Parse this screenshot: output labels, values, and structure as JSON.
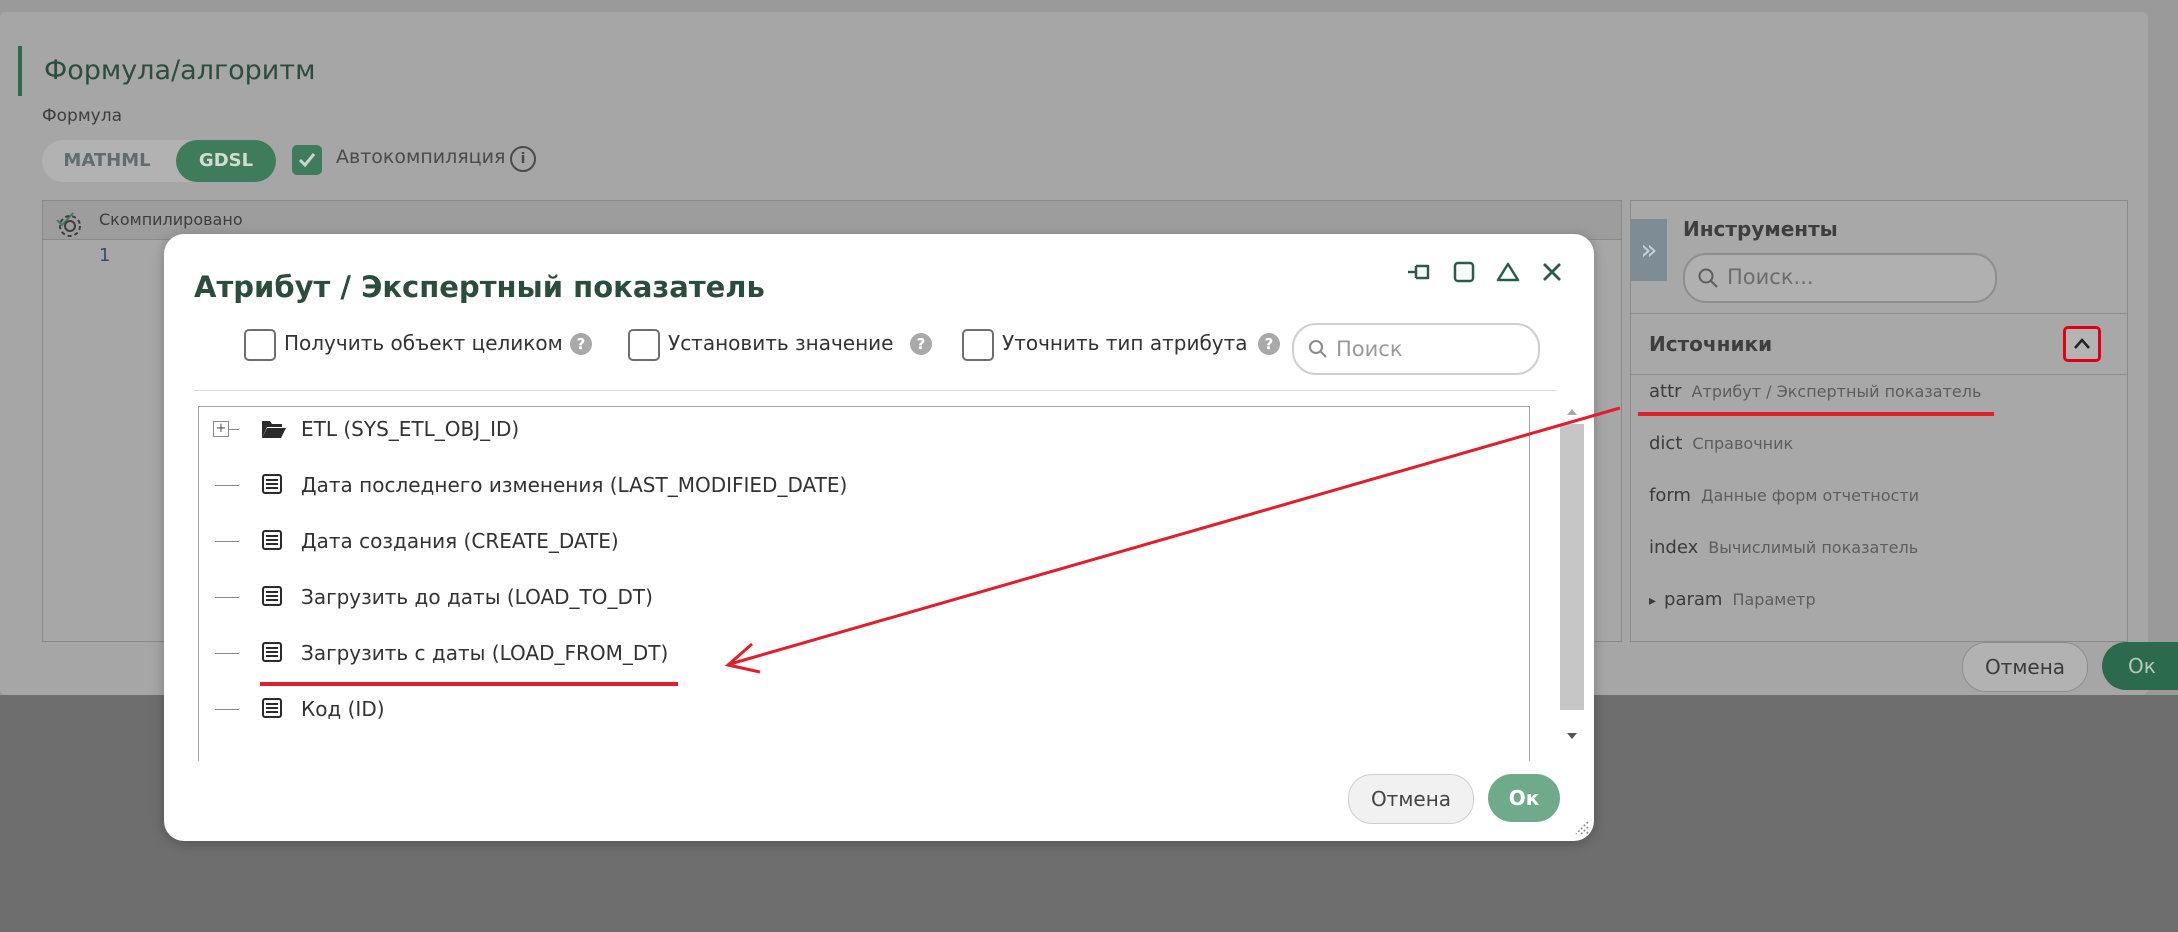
{
  "background": {
    "title": "Формула/алгоритм",
    "formula_label": "Формула",
    "tabs": [
      {
        "label": "MATHML"
      },
      {
        "label": "GDSL"
      }
    ],
    "autocompile_label": "Автокомпиляция",
    "info_glyph": "i",
    "editor": {
      "status": "Скомпилировано",
      "line_number": "1"
    },
    "tools": {
      "toggle_glyph": "»",
      "title": "Инструменты",
      "search_placeholder": "Поиск...",
      "sources_title": "Источники",
      "sources": [
        {
          "key": "attr",
          "label": "Атрибут / Экспертный показатель"
        },
        {
          "key": "dict",
          "label": "Справочник"
        },
        {
          "key": "form",
          "label": "Данные форм отчетности"
        },
        {
          "key": "index",
          "label": "Вычислимый показатель"
        },
        {
          "key": "param",
          "label": "Параметр"
        }
      ],
      "param_glyph": "▸"
    },
    "cancel_label": "Отмена",
    "ok_label": "Ок"
  },
  "modal": {
    "title": "Атрибут / Экспертный показатель",
    "options": [
      {
        "label": "Получить объект целиком"
      },
      {
        "label": "Установить значение"
      },
      {
        "label": "Уточнить тип атрибута"
      }
    ],
    "help_glyph": "?",
    "search_placeholder": "Поиск",
    "tree": [
      {
        "label": "ETL (SYS_ETL_OBJ_ID)",
        "icon": "folder-open-icon"
      },
      {
        "label": "Дата последнего изменения (LAST_MODIFIED_DATE)",
        "icon": "list-icon"
      },
      {
        "label": "Дата создания (CREATE_DATE)",
        "icon": "list-icon"
      },
      {
        "label": "Загрузить до даты (LOAD_TO_DT)",
        "icon": "list-icon"
      },
      {
        "label": "Загрузить с даты (LOAD_FROM_DT)",
        "icon": "list-icon"
      },
      {
        "label": "Код (ID)",
        "icon": "list-icon"
      }
    ],
    "expander_glyph": "+",
    "cancel_label": "Отмена",
    "ok_label": "Ок"
  },
  "colors": {
    "accent": "#3f7c5c",
    "annotation": "#e11e2a"
  }
}
